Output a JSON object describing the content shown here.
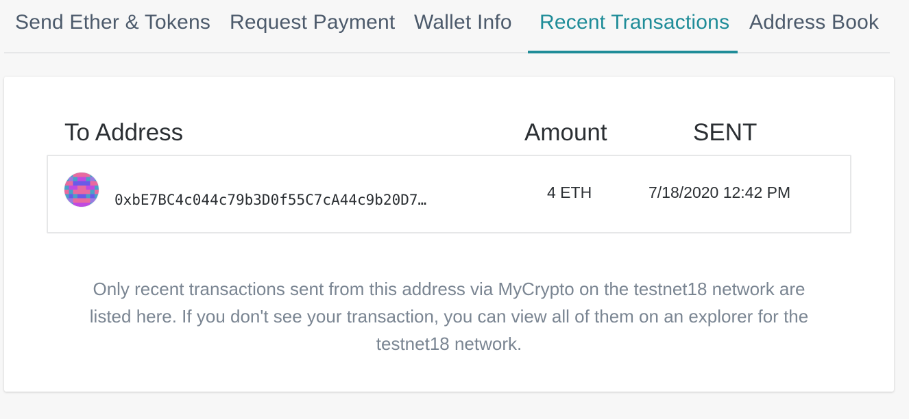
{
  "tabs": [
    {
      "label": "Send Ether & Tokens",
      "active": false
    },
    {
      "label": "Request Payment",
      "active": false
    },
    {
      "label": "Wallet Info",
      "active": false
    },
    {
      "label": "Recent Transactions",
      "active": true
    },
    {
      "label": "Address Book",
      "active": false
    }
  ],
  "table": {
    "headers": [
      "To Address",
      "Amount",
      "SENT"
    ],
    "rows": [
      {
        "to_address": "0xbE7BC4c044c79b3D0f55C7cA44c9b20D7…",
        "amount": "4 ETH",
        "sent": "7/18/2020 12:42 PM",
        "identicon": "identicon"
      }
    ]
  },
  "note": "Only recent transactions sent from this address via MyCrypto on the testnet18 network are listed here. If you don't see your transaction, you can view all of them on an explorer for the testnet18 network.",
  "colors": {
    "accent": "#1f8c98",
    "tab_text": "#4c5a6b",
    "note_text": "#7a8592"
  }
}
